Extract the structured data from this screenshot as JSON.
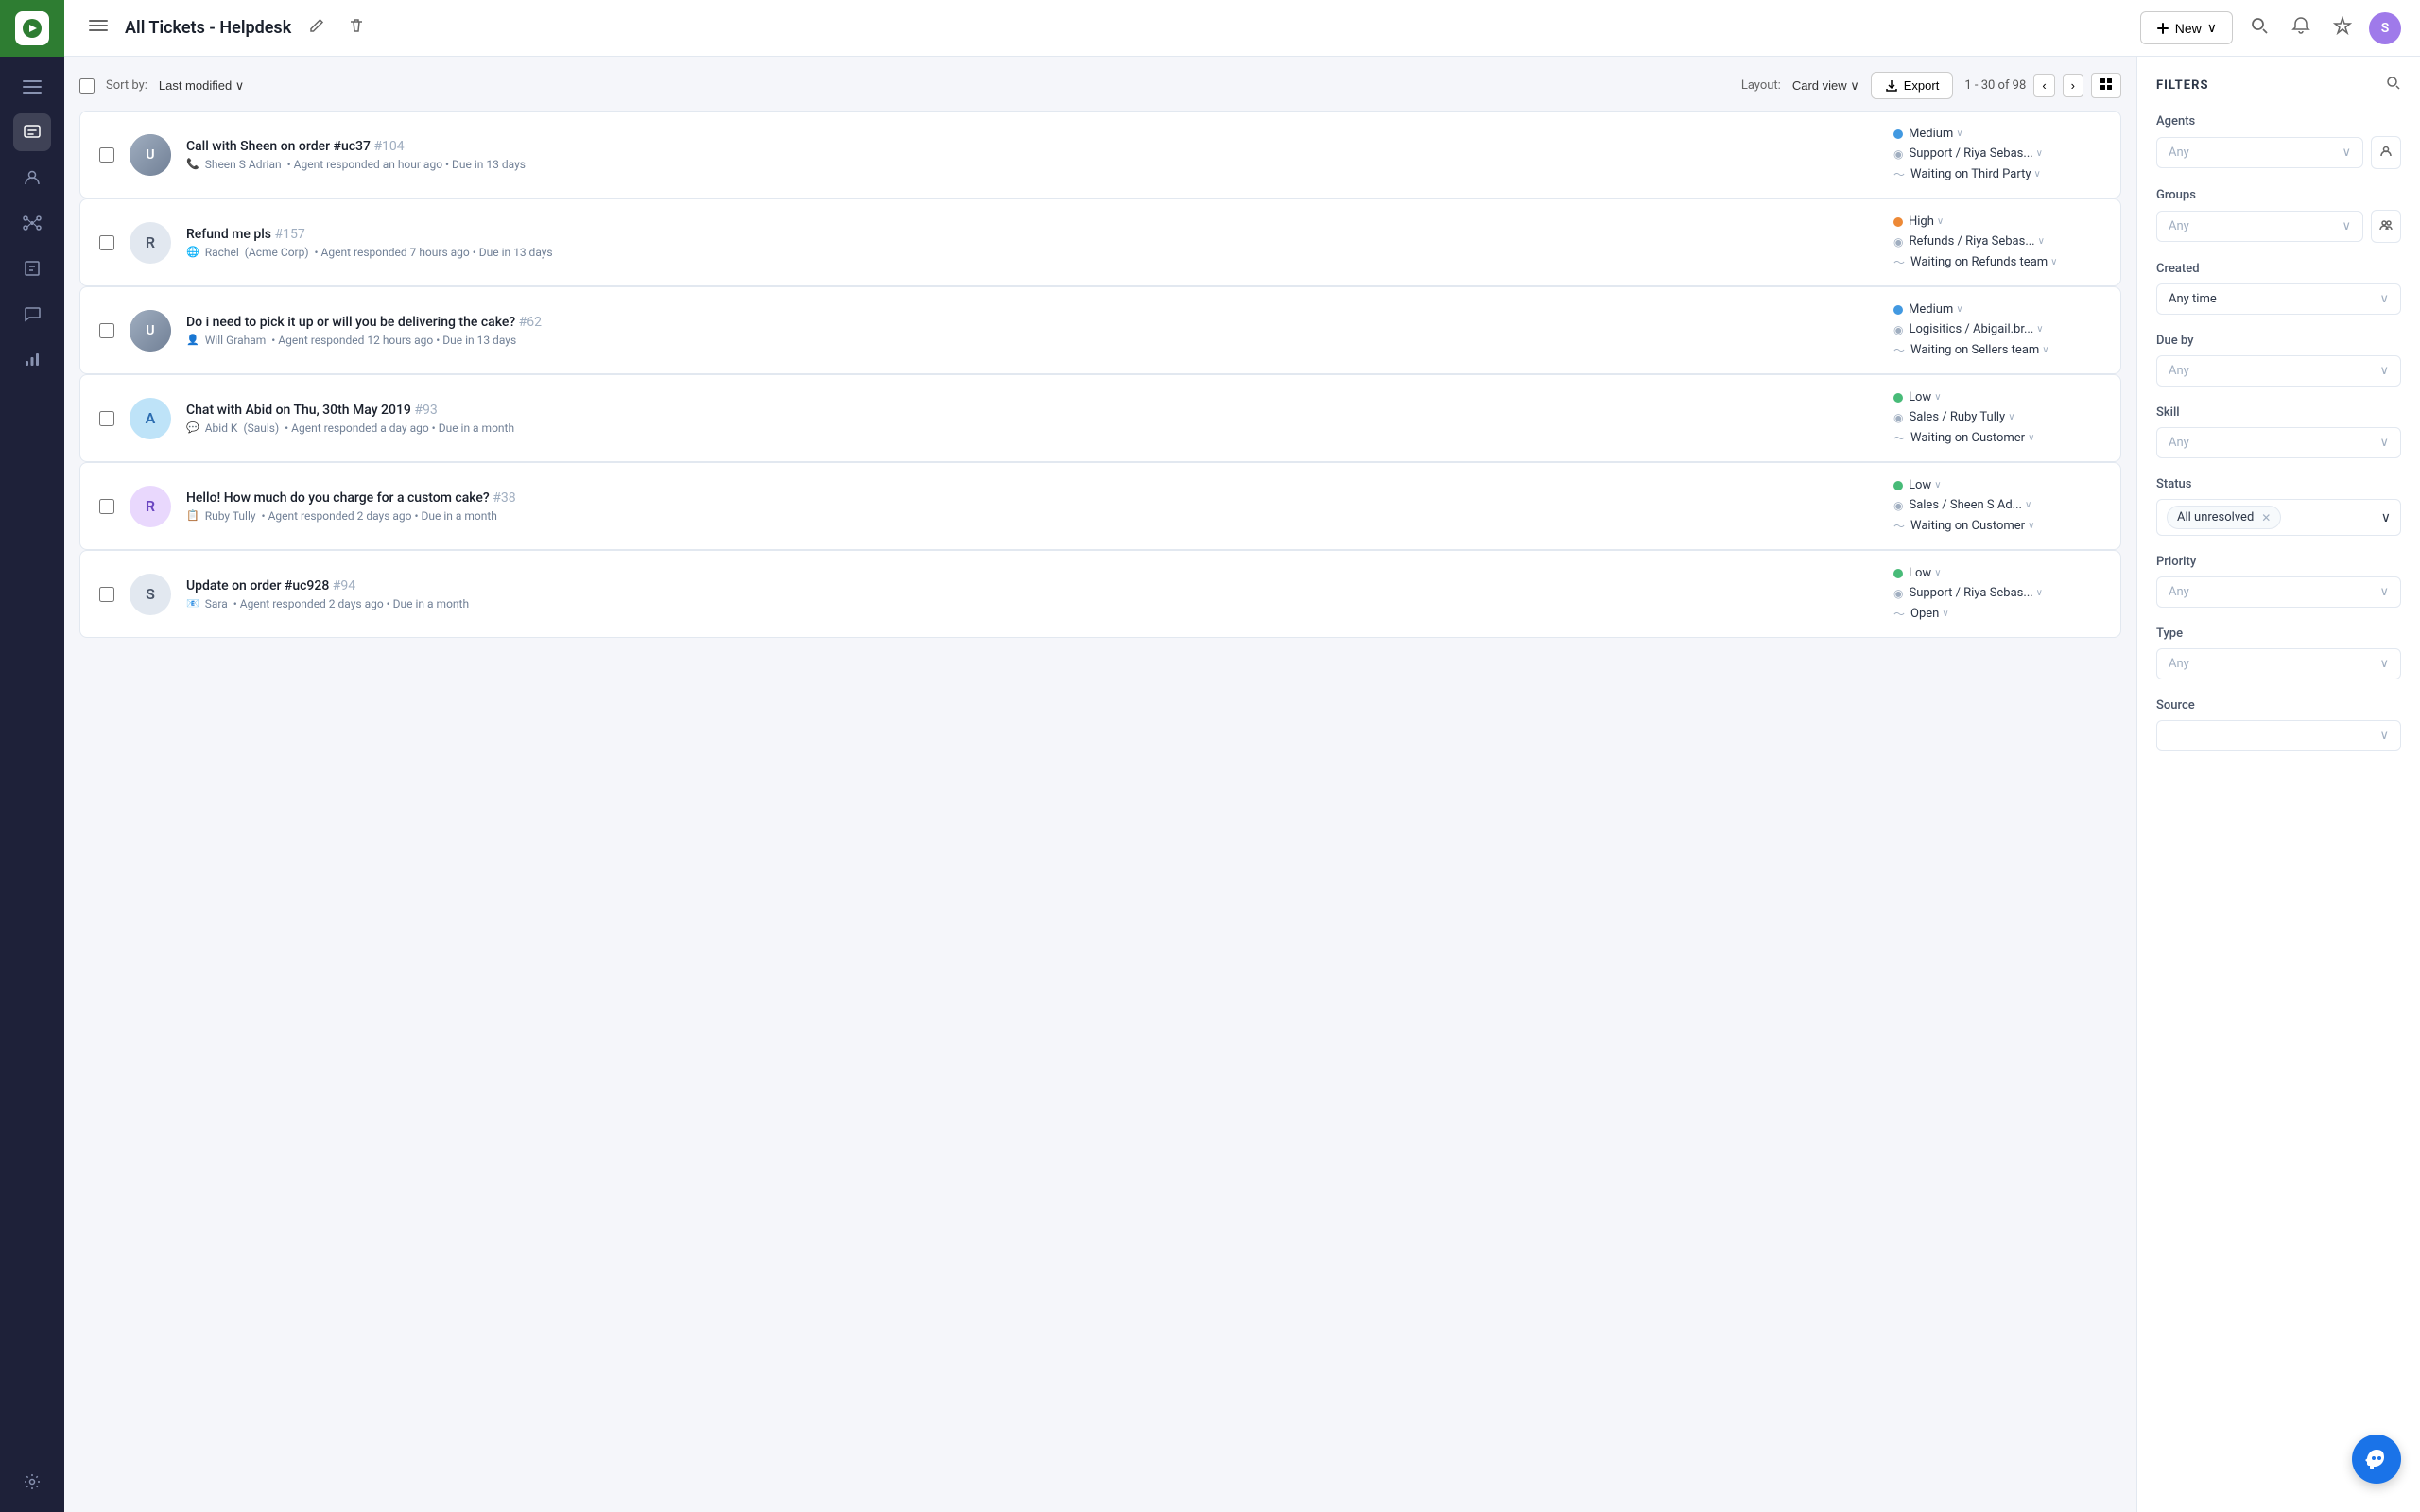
{
  "app": {
    "logo_text": "🎵"
  },
  "top_nav": {
    "title": "All Tickets - Helpdesk",
    "new_btn_label": "New",
    "edit_icon": "✎",
    "delete_icon": "🗑"
  },
  "sub_bar": {
    "sort_label": "Sort by:",
    "sort_value": "Last modified ∨",
    "layout_label": "Layout:",
    "layout_value": "Card view ∨",
    "export_label": "Export",
    "pagination": "1 - 30 of 98"
  },
  "filters": {
    "title": "FILTERS",
    "agents": {
      "label": "Agents",
      "placeholder": "Any"
    },
    "groups": {
      "label": "Groups",
      "placeholder": "Any"
    },
    "created": {
      "label": "Created",
      "value": "Any time"
    },
    "due_by": {
      "label": "Due by",
      "placeholder": "Any"
    },
    "skill": {
      "label": "Skill",
      "placeholder": "Any"
    },
    "status": {
      "label": "Status",
      "value": "All unresolved"
    },
    "priority": {
      "label": "Priority",
      "placeholder": "Any"
    },
    "type": {
      "label": "Type",
      "placeholder": "Any"
    },
    "source": {
      "label": "Source"
    }
  },
  "tickets": [
    {
      "id": "t1",
      "avatar_text": "",
      "avatar_color": "#718096",
      "avatar_img": true,
      "title": "Call with Sheen on order #uc37",
      "ticket_num": "#104",
      "contact_icon": "📞",
      "contact_name": "Sheen S Adrian",
      "meta": "Agent responded an hour ago • Due in 13 days",
      "priority": "Medium",
      "priority_color": "blue",
      "team": "Support / Riya Sebas...",
      "status_tag": "Waiting on Third Party"
    },
    {
      "id": "t2",
      "avatar_text": "R",
      "avatar_color": "#e2e8f0",
      "avatar_text_color": "#4a5568",
      "title": "Refund me pls",
      "ticket_num": "#157",
      "contact_icon": "🌐",
      "contact_name": "Rachel",
      "contact_org": "(Acme Corp)",
      "meta": "Agent responded 7 hours ago • Due in 13 days",
      "priority": "High",
      "priority_color": "orange",
      "team": "Refunds / Riya Sebas...",
      "status_tag": "Waiting on Refunds team"
    },
    {
      "id": "t3",
      "avatar_text": "",
      "avatar_color": "#718096",
      "avatar_img": true,
      "title": "Do i need to pick it up or will you be delivering the cake?",
      "ticket_num": "#62",
      "contact_icon": "👤",
      "contact_name": "Will Graham",
      "meta": "Agent responded 12 hours ago • Due in 13 days",
      "priority": "Medium",
      "priority_color": "blue",
      "team": "Logisitics / Abigail.br...",
      "status_tag": "Waiting on Sellers team"
    },
    {
      "id": "t4",
      "avatar_text": "A",
      "avatar_color": "#bee3f8",
      "avatar_text_color": "#2b6cb0",
      "title": "Chat with Abid on Thu, 30th May 2019",
      "ticket_num": "#93",
      "contact_icon": "💬",
      "contact_name": "Abid K",
      "contact_org": "(Sauls)",
      "meta": "Agent responded a day ago • Due in a month",
      "priority": "Low",
      "priority_color": "green",
      "team": "Sales / Ruby Tully",
      "status_tag": "Waiting on Customer"
    },
    {
      "id": "t5",
      "avatar_text": "R",
      "avatar_color": "#e9d8fd",
      "avatar_text_color": "#6b46c1",
      "title": "Hello! How much do you charge for a custom cake?",
      "ticket_num": "#38",
      "contact_icon": "📋",
      "contact_name": "Ruby Tully",
      "meta": "Agent responded 2 days ago • Due in a month",
      "priority": "Low",
      "priority_color": "green",
      "team": "Sales / Sheen S Ad...",
      "status_tag": "Waiting on Customer"
    },
    {
      "id": "t6",
      "avatar_text": "S",
      "avatar_color": "#e2e8f0",
      "avatar_text_color": "#4a5568",
      "title": "Update on order #uc928",
      "ticket_num": "#94",
      "contact_icon": "📧",
      "contact_name": "Sara",
      "meta": "Agent responded 2 days ago • Due in a month",
      "priority": "Low",
      "priority_color": "green",
      "team": "Support / Riya Sebas...",
      "status_tag": "Open"
    }
  ],
  "sidebar": {
    "items": [
      {
        "icon": "☰",
        "name": "menu"
      },
      {
        "icon": "🎫",
        "name": "tickets",
        "active": true
      },
      {
        "icon": "👥",
        "name": "contacts"
      },
      {
        "icon": "🔗",
        "name": "network"
      },
      {
        "icon": "📚",
        "name": "knowledge"
      },
      {
        "icon": "💬",
        "name": "chat"
      },
      {
        "icon": "📊",
        "name": "reports"
      },
      {
        "icon": "⚙️",
        "name": "settings"
      }
    ]
  }
}
